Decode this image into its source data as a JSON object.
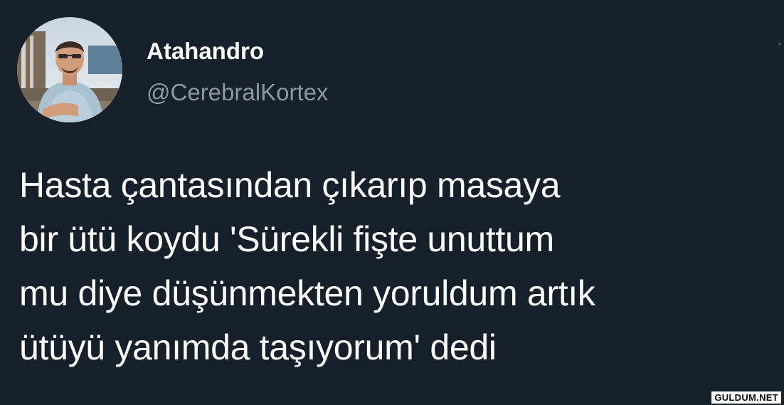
{
  "tweet": {
    "display_name": "Atahandro",
    "handle": "@CerebralKortex",
    "text_lines": [
      "Hasta çantasından çıkarıp masaya",
      "bir ütü koydu 'Sürekli fişte unuttum",
      "mu diye düşünmekten yoruldum artık",
      "ütüyü yanımda taşıyorum' dedi"
    ]
  },
  "watermark": "GULDUM.NET",
  "colors": {
    "background": "#15202b",
    "text_primary": "#ffffff",
    "text_secondary": "#8899a6"
  },
  "icons": {
    "avatar": "profile-photo",
    "more": "more-options-icon"
  }
}
